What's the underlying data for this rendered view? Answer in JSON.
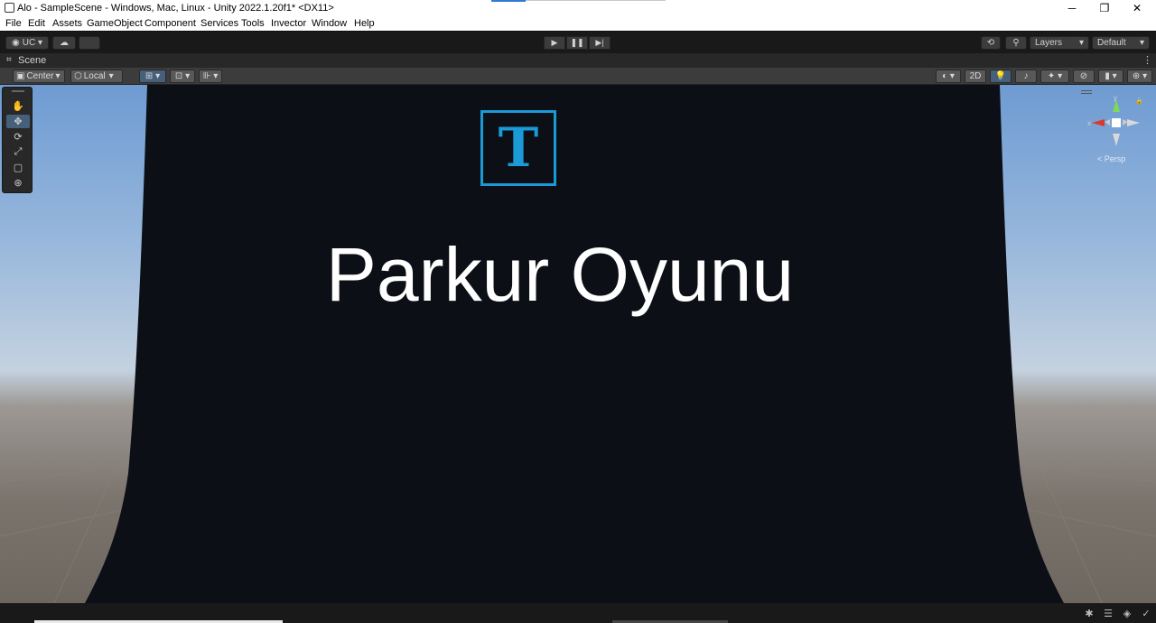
{
  "window": {
    "title": "Alo - SampleScene - Windows, Mac, Linux - Unity 2022.1.20f1* <DX11>",
    "minimize": "─",
    "restore": "❐",
    "close": "✕"
  },
  "menu": [
    "File",
    "Edit",
    "Assets",
    "GameObject",
    "Component",
    "Services",
    "Tools",
    "Invector",
    "Window",
    "Help"
  ],
  "toolbar": {
    "account": "UC ▾",
    "cloud": "☁",
    "play": "▶",
    "pause": "❚❚",
    "step": "▶|",
    "history": "⟲",
    "search": "⚲",
    "layers": "Layers",
    "layout": "Default",
    "more": "⋮"
  },
  "scene_tab": {
    "icon": "⌗",
    "label": "Scene",
    "more": "⋮"
  },
  "scene_toolbar": {
    "pivot": "Center",
    "space": "Local",
    "mode_2d": "2D",
    "icons": [
      "grid-snap-icon",
      "increment-snap-icon",
      "shading-mode-icon",
      "lighting-icon",
      "audio-icon",
      "effects-icon",
      "hidden-objects-icon",
      "camera-icon",
      "gizmos-icon"
    ]
  },
  "tools": [
    {
      "name": "hand-tool",
      "glyph": "✋",
      "active": false
    },
    {
      "name": "move-tool",
      "glyph": "✥",
      "active": true
    },
    {
      "name": "rotate-tool",
      "glyph": "⟳",
      "active": false
    },
    {
      "name": "scale-tool",
      "glyph": "⤢",
      "active": false
    },
    {
      "name": "rect-tool",
      "glyph": "▢",
      "active": false
    },
    {
      "name": "transform-tool",
      "glyph": "⊛",
      "active": false
    }
  ],
  "gizmo": {
    "y_label": "y",
    "x_label": "x",
    "projection": "< Persp",
    "lock": "🔒"
  },
  "canvas": {
    "logo_letter": "T",
    "heading": "Parkur Oyunu",
    "logo_color": "#1a9ad6",
    "panel_color": "#0c1016"
  },
  "statusbar": {
    "icons": [
      "debug-icon",
      "stack-icon",
      "layers-icon",
      "check-icon"
    ]
  },
  "colors": {
    "accent": "#46607c",
    "editor_bg": "#191919"
  }
}
